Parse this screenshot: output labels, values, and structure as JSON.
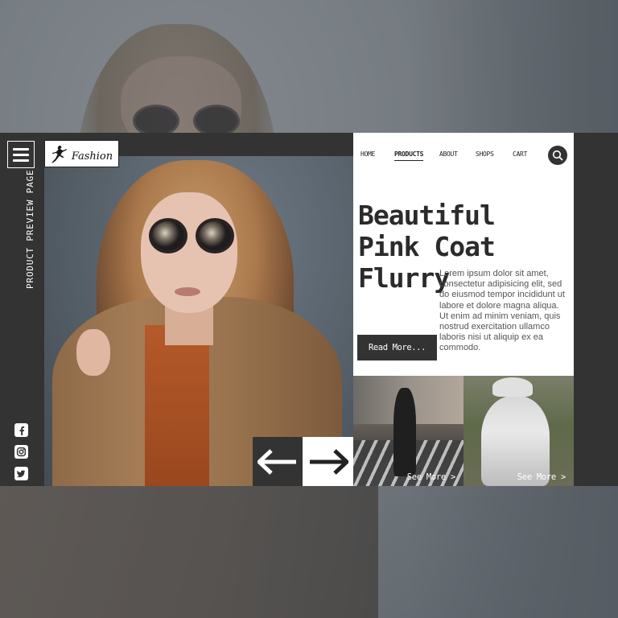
{
  "sidebar": {
    "vertical_label": "PRODUCT PREVIEW PAGE",
    "menu_icon": "hamburger-menu-icon",
    "socials": [
      {
        "name": "facebook-icon"
      },
      {
        "name": "instagram-icon"
      },
      {
        "name": "twitter-icon"
      }
    ]
  },
  "logo": {
    "text": "Fashion"
  },
  "nav": {
    "items": [
      {
        "label": "HOME",
        "active": false
      },
      {
        "label": "PRODUCTS",
        "active": true
      },
      {
        "label": "ABOUT",
        "active": false
      },
      {
        "label": "SHOPS",
        "active": false
      },
      {
        "label": "CART",
        "active": false
      }
    ],
    "search_icon": "search-icon"
  },
  "hero": {
    "headline_lines": [
      "Beautiful",
      "Pink Coat",
      "Flurry"
    ],
    "description": "Lorem ipsum dolor sit amet, consectetur adipisicing elit, sed do eiusmod tempor incididunt ut labore et dolore magna aliqua. Ut enim ad minim veniam, quis nostrud exercitation ullamco laboris nisi ut aliquip ex ea commodo.",
    "read_more_label": "Read More..."
  },
  "tiles": [
    {
      "see_more": "See More  >"
    },
    {
      "see_more": "See More  >"
    }
  ],
  "arrows": {
    "prev_icon": "arrow-left-icon",
    "next_icon": "arrow-right-icon"
  },
  "colors": {
    "dark": "#333333",
    "panel": "#ffffff",
    "text": "#2b2b2b"
  }
}
